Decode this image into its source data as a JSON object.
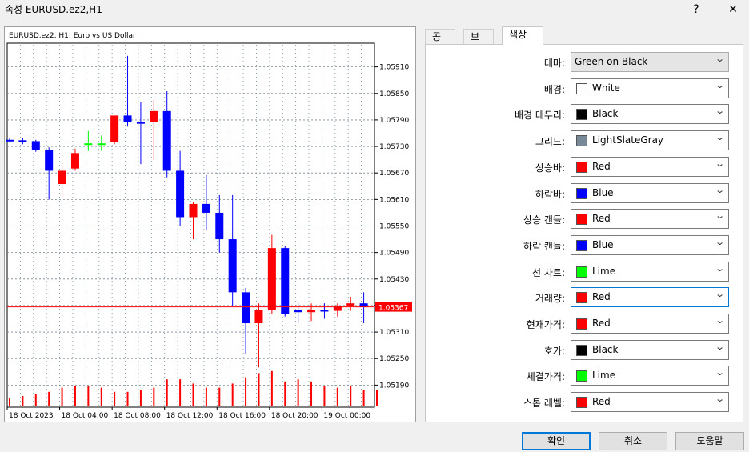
{
  "window": {
    "title": "속성 EURUSD.ez2,H1",
    "help_label": "?",
    "close_label": "✕"
  },
  "chart": {
    "header": "EURUSD.ez2, H1:  Euro vs US Dollar",
    "current_price": "1.05367",
    "price_ticks": [
      "1.05910",
      "1.05850",
      "1.05790",
      "1.05730",
      "1.05670",
      "1.05610",
      "1.05550",
      "1.05490",
      "1.05430",
      "1.05370",
      "1.05310",
      "1.05250",
      "1.05190"
    ],
    "time_ticks": [
      "18 Oct 2023",
      "18 Oct 04:00",
      "18 Oct 08:00",
      "18 Oct 12:00",
      "18 Oct 16:00",
      "18 Oct 20:00",
      "19 Oct 00:00"
    ]
  },
  "chart_data": {
    "type": "candlestick",
    "title": "EURUSD.ez2, H1:  Euro vs US Dollar",
    "ylim": [
      1.0514,
      1.0596
    ],
    "candles": [
      {
        "o": 1.05745,
        "h": 1.05748,
        "l": 1.0574,
        "c": 1.05742,
        "color": "blue"
      },
      {
        "o": 1.05744,
        "h": 1.0575,
        "l": 1.05735,
        "c": 1.05742,
        "color": "blue"
      },
      {
        "o": 1.05742,
        "h": 1.05745,
        "l": 1.05718,
        "c": 1.05722,
        "color": "blue"
      },
      {
        "o": 1.05722,
        "h": 1.05728,
        "l": 1.0561,
        "c": 1.05675,
        "color": "blue"
      },
      {
        "o": 1.05675,
        "h": 1.05695,
        "l": 1.05615,
        "c": 1.05645,
        "color": "red"
      },
      {
        "o": 1.0568,
        "h": 1.05725,
        "l": 1.05675,
        "c": 1.05715,
        "color": "red"
      },
      {
        "o": 1.05737,
        "h": 1.05765,
        "l": 1.0572,
        "c": 1.05737,
        "color": "lime"
      },
      {
        "o": 1.05737,
        "h": 1.05755,
        "l": 1.0572,
        "c": 1.05737,
        "color": "lime"
      },
      {
        "o": 1.0574,
        "h": 1.0579,
        "l": 1.05735,
        "c": 1.058,
        "color": "red"
      },
      {
        "o": 1.058,
        "h": 1.05935,
        "l": 1.05775,
        "c": 1.05785,
        "color": "blue"
      },
      {
        "o": 1.05785,
        "h": 1.0583,
        "l": 1.0569,
        "c": 1.05785,
        "color": "blue"
      },
      {
        "o": 1.05785,
        "h": 1.05835,
        "l": 1.057,
        "c": 1.0581,
        "color": "red"
      },
      {
        "o": 1.0581,
        "h": 1.05855,
        "l": 1.0566,
        "c": 1.05675,
        "color": "blue"
      },
      {
        "o": 1.05675,
        "h": 1.0572,
        "l": 1.0555,
        "c": 1.0557,
        "color": "blue"
      },
      {
        "o": 1.0557,
        "h": 1.05605,
        "l": 1.0552,
        "c": 1.056,
        "color": "red"
      },
      {
        "o": 1.056,
        "h": 1.05665,
        "l": 1.0554,
        "c": 1.0558,
        "color": "blue"
      },
      {
        "o": 1.0558,
        "h": 1.0562,
        "l": 1.0549,
        "c": 1.0552,
        "color": "blue"
      },
      {
        "o": 1.0552,
        "h": 1.0562,
        "l": 1.0537,
        "c": 1.054,
        "color": "blue"
      },
      {
        "o": 1.054,
        "h": 1.0541,
        "l": 1.0526,
        "c": 1.0533,
        "color": "blue"
      },
      {
        "o": 1.0533,
        "h": 1.05375,
        "l": 1.0523,
        "c": 1.0536,
        "color": "red"
      },
      {
        "o": 1.0536,
        "h": 1.0553,
        "l": 1.0535,
        "c": 1.055,
        "color": "red"
      },
      {
        "o": 1.055,
        "h": 1.05505,
        "l": 1.05345,
        "c": 1.0535,
        "color": "blue"
      },
      {
        "o": 1.05355,
        "h": 1.05375,
        "l": 1.0533,
        "c": 1.0536,
        "color": "blue"
      },
      {
        "o": 1.0536,
        "h": 1.05375,
        "l": 1.05335,
        "c": 1.05355,
        "color": "red"
      },
      {
        "o": 1.0536,
        "h": 1.05375,
        "l": 1.0534,
        "c": 1.05358,
        "color": "blue"
      },
      {
        "o": 1.05358,
        "h": 1.05375,
        "l": 1.05345,
        "c": 1.0537,
        "color": "red"
      },
      {
        "o": 1.0537,
        "h": 1.0539,
        "l": 1.05358,
        "c": 1.05375,
        "color": "red"
      },
      {
        "o": 1.05375,
        "h": 1.054,
        "l": 1.0533,
        "c": 1.05367,
        "color": "blue"
      }
    ],
    "volumes": [
      4,
      5,
      6,
      7,
      9,
      10,
      10,
      9,
      7,
      7,
      8,
      9,
      13,
      13,
      11,
      9,
      9,
      11,
      14,
      16,
      17,
      12,
      13,
      12,
      10,
      9,
      10,
      8,
      8
    ],
    "current_price": 1.05367,
    "grid": true,
    "colors": {
      "up": "#ff0000",
      "down": "#0000ff",
      "line": "#00ff00",
      "volume": "#ff0000",
      "price_line": "#ff0000",
      "grid": "#778899"
    }
  },
  "tabs": [
    {
      "label": "공통"
    },
    {
      "label": "보기"
    },
    {
      "label": "색상"
    }
  ],
  "settings": [
    {
      "label": "테마:",
      "value": "Green on Black",
      "color": null
    },
    {
      "label": "배경:",
      "value": "White",
      "color": "#ffffff"
    },
    {
      "label": "배경 테두리:",
      "value": "Black",
      "color": "#000000"
    },
    {
      "label": "그리드:",
      "value": "LightSlateGray",
      "color": "#778899"
    },
    {
      "label": "상승바:",
      "value": "Red",
      "color": "#ff0000"
    },
    {
      "label": "하락바:",
      "value": "Blue",
      "color": "#0000ff"
    },
    {
      "label": "상승 캔들:",
      "value": "Red",
      "color": "#ff0000"
    },
    {
      "label": "하락 캔들:",
      "value": "Blue",
      "color": "#0000ff"
    },
    {
      "label": "선 차트:",
      "value": "Lime",
      "color": "#00ff00"
    },
    {
      "label": "거래량:",
      "value": "Red",
      "color": "#ff0000"
    },
    {
      "label": "현재가격:",
      "value": "Red",
      "color": "#ff0000"
    },
    {
      "label": "호가:",
      "value": "Black",
      "color": "#000000"
    },
    {
      "label": "체결가격:",
      "value": "Lime",
      "color": "#00ff00"
    },
    {
      "label": "스톱 레벨:",
      "value": "Red",
      "color": "#ff0000"
    }
  ],
  "buttons": {
    "ok": "확인",
    "cancel": "취소",
    "help": "도움말"
  }
}
